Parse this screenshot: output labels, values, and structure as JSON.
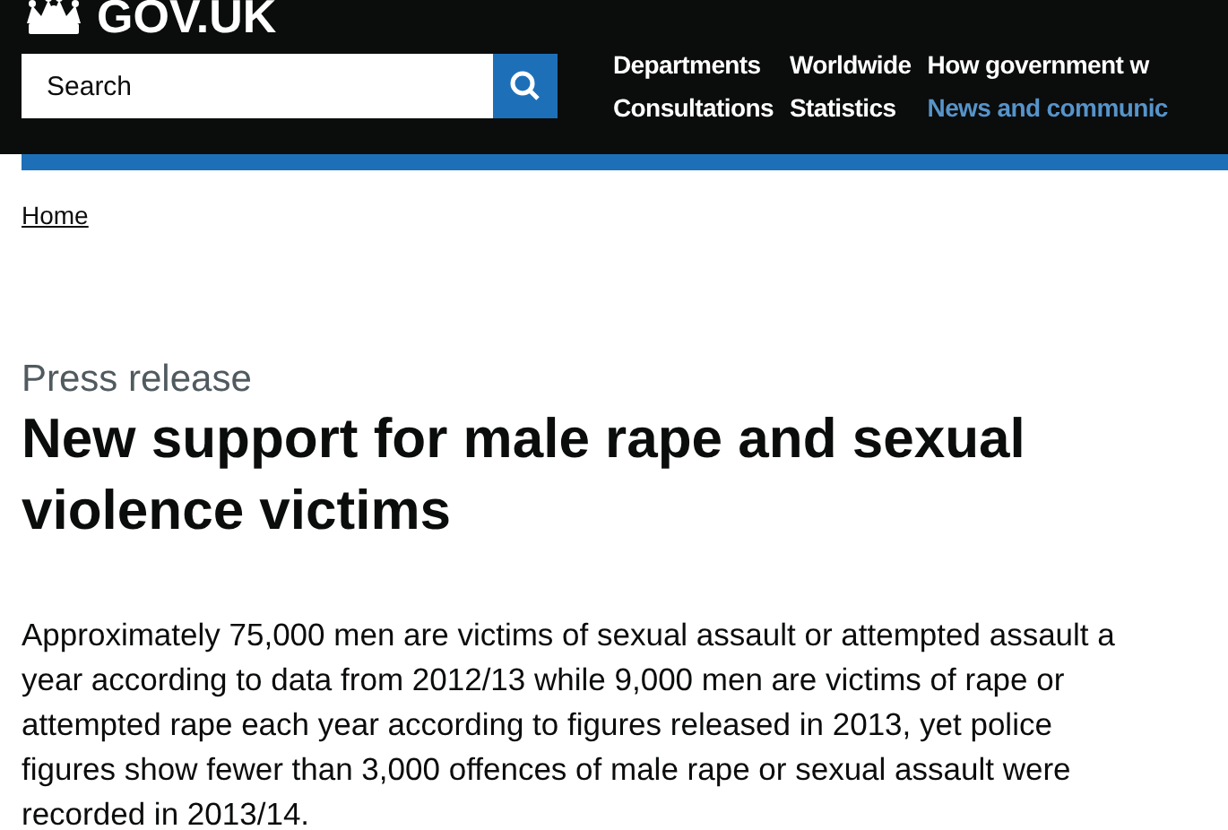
{
  "header": {
    "logo": "GOV.UK",
    "search": {
      "placeholder": "Search"
    },
    "nav": [
      {
        "label": "Departments",
        "selected": false
      },
      {
        "label": "Worldwide",
        "selected": false
      },
      {
        "label": "How government w",
        "selected": false
      },
      {
        "label": "Consultations",
        "selected": false
      },
      {
        "label": "Statistics",
        "selected": false
      },
      {
        "label": "News and communic",
        "selected": true
      }
    ]
  },
  "breadcrumb": [
    "Home"
  ],
  "article": {
    "type": "Press release",
    "title": "New support for male rape and sexual violence victims",
    "summary": "Approximately 75,000 men are victims of sexual assault or attempted assault a year according to data from 2012/13 while 9,000 men are victims of rape or attempted rape each year according to figures released in 2013, yet police figures show fewer than 3,000 offences of male rape or sexual assault were recorded in 2013/14."
  }
}
